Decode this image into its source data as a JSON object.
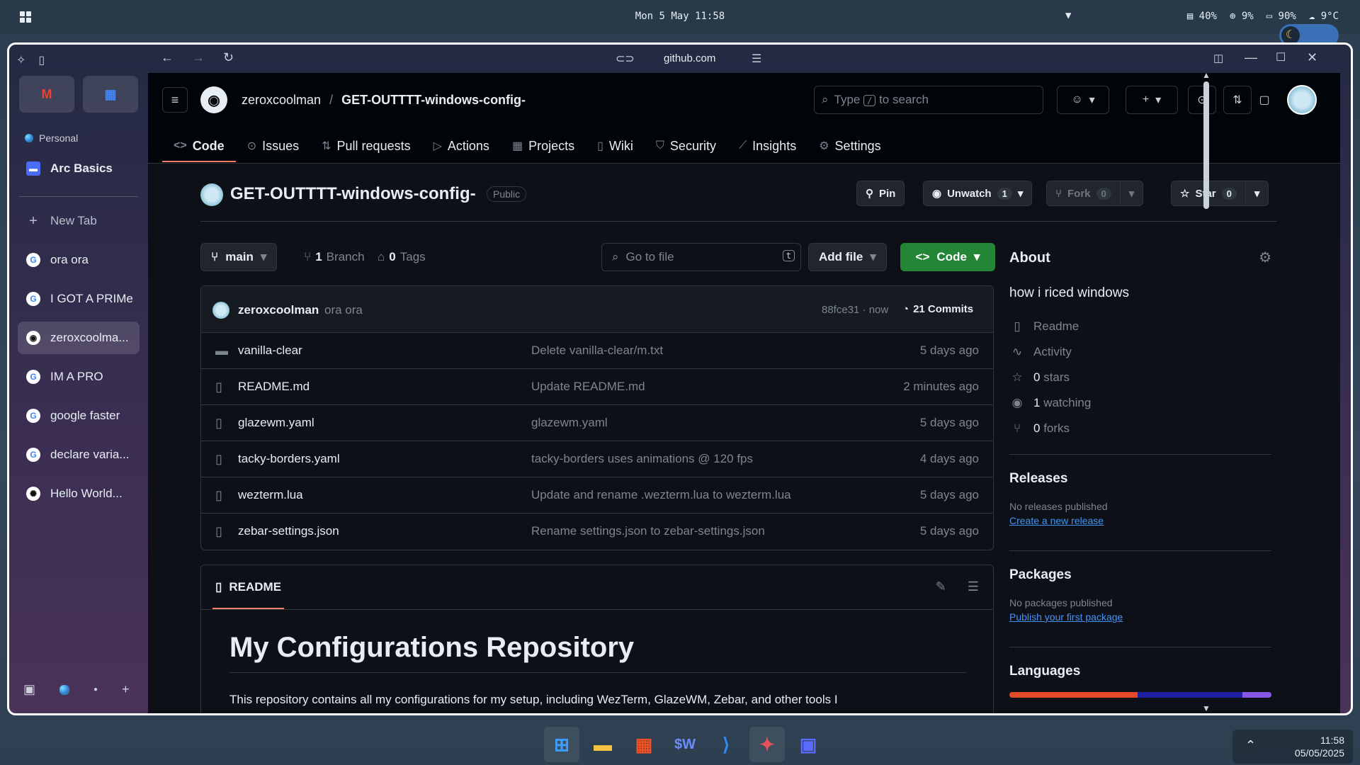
{
  "system": {
    "clock": "Mon 5 May 11:58",
    "stats": [
      "40%",
      "9%",
      "90%",
      "9°C"
    ],
    "accent": "#3b6fb6"
  },
  "browser": {
    "url": "github.com",
    "space_label": "Personal",
    "pinned_folder": "Arc Basics",
    "new_tab": "New Tab",
    "tabs": [
      {
        "label": "ora ora",
        "icon": "google-icon"
      },
      {
        "label": "I GOT A PRIMe",
        "icon": "google-icon"
      },
      {
        "label": "zeroxcoolma...",
        "icon": "github-icon"
      },
      {
        "label": "IM A PRO",
        "icon": "google-icon"
      },
      {
        "label": "google faster",
        "icon": "google-icon"
      },
      {
        "label": "declare varia...",
        "icon": "google-icon"
      },
      {
        "label": "Hello World...",
        "icon": "openai-icon"
      }
    ]
  },
  "github": {
    "owner": "zeroxcoolman",
    "repo": "GET-OUTTTT-windows-config-",
    "search_placeholder": "Type / to search",
    "search_key": "/",
    "nav": [
      "Code",
      "Issues",
      "Pull requests",
      "Actions",
      "Projects",
      "Wiki",
      "Security",
      "Insights",
      "Settings"
    ],
    "visibility": "Public",
    "pin": "Pin",
    "unwatch": "Unwatch",
    "unwatch_count": "1",
    "fork": "Fork",
    "fork_count": "0",
    "star": "Star",
    "star_count": "0",
    "branch": "main",
    "branches_count": "1",
    "branches_label": "Branch",
    "tags_count": "0",
    "tags_label": "Tags",
    "goto_placeholder": "Go to file",
    "goto_key": "t",
    "add_file": "Add file",
    "code_btn": "Code",
    "commit": {
      "user": "zeroxcoolman",
      "message": "ora ora",
      "hash": "88fce31 · now",
      "count": "21 Commits"
    },
    "files": [
      {
        "name": "vanilla-clear",
        "type": "folder",
        "message": "Delete vanilla-clear/m.txt",
        "date": "5 days ago"
      },
      {
        "name": "README.md",
        "type": "file",
        "message": "Update README.md",
        "date": "2 minutes ago"
      },
      {
        "name": "glazewm.yaml",
        "type": "file",
        "message": "glazewm.yaml",
        "date": "5 days ago"
      },
      {
        "name": "tacky-borders.yaml",
        "type": "file",
        "message": "tacky-borders uses animations @ 120 fps",
        "date": "4 days ago"
      },
      {
        "name": "wezterm.lua",
        "type": "file",
        "message": "Update and rename .wezterm.lua to wezterm.lua",
        "date": "5 days ago"
      },
      {
        "name": "zebar-settings.json",
        "type": "file",
        "message": "Rename settings.json to zebar-settings.json",
        "date": "5 days ago"
      }
    ],
    "readme": {
      "tab": "README",
      "title": "My Configurations Repository",
      "intro": "This repository contains all my configurations for my setup, including WezTerm, GlazeWM, Zebar, and other tools I"
    },
    "about": {
      "heading": "About",
      "description": "how i riced windows",
      "readme": "Readme",
      "activity": "Activity",
      "stars_count": "0",
      "stars_label": "stars",
      "watching_count": "1",
      "watching_label": "watching",
      "forks_count": "0",
      "forks_label": "forks"
    },
    "releases": {
      "heading": "Releases",
      "text": "No releases published",
      "link": "Create a new release"
    },
    "packages": {
      "heading": "Packages",
      "text": "No packages published",
      "link": "Publish your first package"
    },
    "languages": {
      "heading": "Languages",
      "colors": [
        "#e34c26",
        "#1f1fa3",
        "#8957e5"
      ]
    }
  },
  "taskbar": {
    "time": "11:58",
    "date": "05/05/2025"
  }
}
